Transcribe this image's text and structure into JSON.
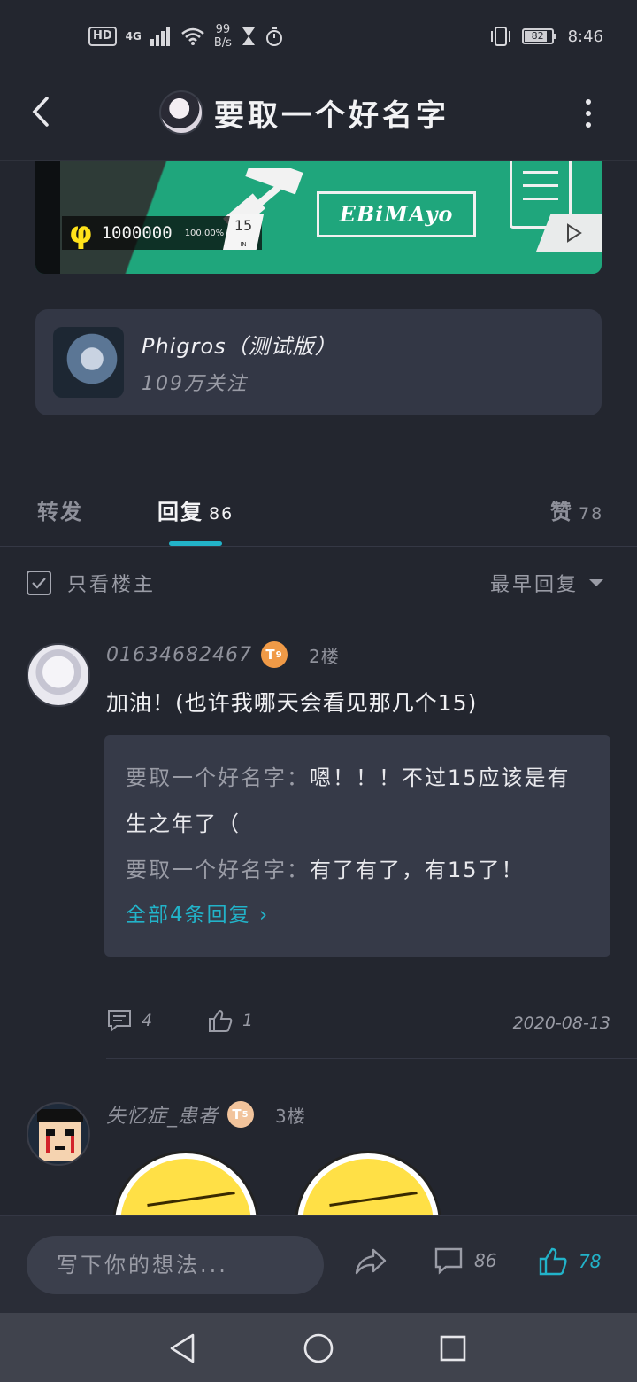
{
  "status_bar": {
    "hd": "HD",
    "network": "4G",
    "speed_value": "99",
    "speed_unit": "B/s",
    "battery": "82",
    "time": "8:46"
  },
  "header": {
    "title": "要取一个好名字"
  },
  "banner": {
    "phi_symbol": "φ",
    "score": "1000000",
    "accuracy": "100.00%",
    "level": "15",
    "level_tag": "IN",
    "logo_text": "EBiMAyo"
  },
  "community": {
    "name": "Phigros（测试版）",
    "followers": "109万关注"
  },
  "tabs": [
    {
      "label": "转发",
      "count": ""
    },
    {
      "label": "回复",
      "count": "86"
    },
    {
      "label": "赞",
      "count": "78"
    }
  ],
  "filter": {
    "only_op_label": "只看楼主",
    "sort_label": "最早回复"
  },
  "replies": [
    {
      "username": "01634682467",
      "level": "9",
      "floor": "2楼",
      "content": "加油！(也许我哪天会看见那几个15)",
      "sub_replies": [
        {
          "user": "要取一个好名字：",
          "text": "嗯！！！不过15应该是有生之年了（"
        },
        {
          "user": "要取一个好名字：",
          "text": "有了有了，有15了！"
        }
      ],
      "more_label": "全部4条回复",
      "comment_count": "4",
      "like_count": "1",
      "date": "2020-08-13"
    },
    {
      "username": "失忆症_患者",
      "level": "5",
      "floor": "3楼"
    }
  ],
  "bottom_bar": {
    "input_placeholder": "写下你的想法...",
    "comment_count": "86",
    "like_count": "78"
  },
  "colors": {
    "accent": "#22b3c9",
    "background": "#23262f",
    "card": "#333745",
    "level_orange": "#f09a47"
  }
}
